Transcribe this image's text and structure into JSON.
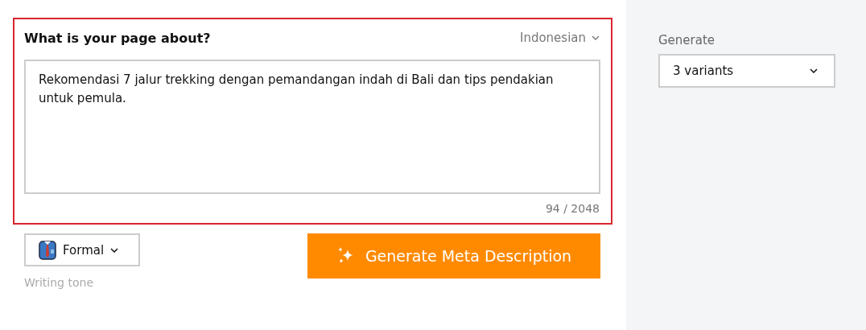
{
  "topic": {
    "label": "What is your page about?",
    "language": "Indonesian",
    "focused": true,
    "value": "Rekomendasi 7 jalur trekking dengan pemandangan indah di Bali dan tips pendakian untuk pemula.",
    "counter": "94 / 2048"
  },
  "tone": {
    "value": "Formal",
    "caption": "Writing tone"
  },
  "generate_button": "Generate Meta Description",
  "sidebar": {
    "label": "Generate",
    "value": "3 variants"
  }
}
